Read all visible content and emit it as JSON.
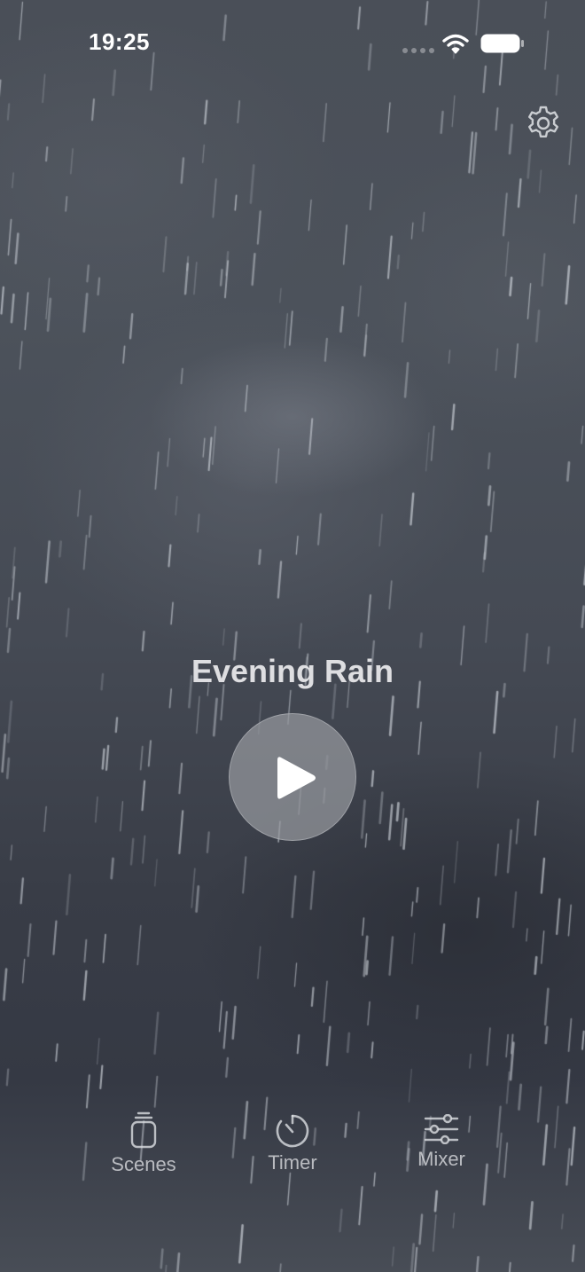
{
  "status_bar": {
    "time": "19:25",
    "icons": [
      "cellular-signal-icon",
      "wifi-icon",
      "battery-icon"
    ]
  },
  "header": {
    "settings_icon": "gear-icon"
  },
  "player": {
    "scene_title": "Evening Rain",
    "play_icon": "play-icon"
  },
  "tabs": [
    {
      "label": "Scenes",
      "icon": "stack-icon"
    },
    {
      "label": "Timer",
      "icon": "timer-icon"
    },
    {
      "label": "Mixer",
      "icon": "sliders-icon"
    }
  ],
  "colors": {
    "background_top": "#4a4f58",
    "background_bottom": "#353944",
    "text": "#ebecee",
    "play_button": "#96999e"
  }
}
